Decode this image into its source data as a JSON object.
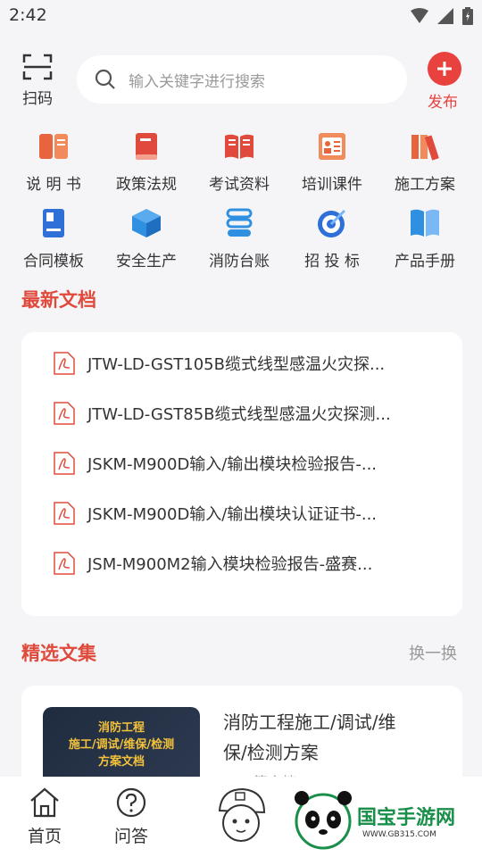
{
  "status": {
    "time": "2:42"
  },
  "topbar": {
    "scan_label": "扫码",
    "search_placeholder": "输入关键字进行搜索",
    "publish_label": "发布"
  },
  "categories": [
    {
      "label": "说 明 书",
      "icon": "book-open-icon",
      "color": "#e8643c"
    },
    {
      "label": "政策法规",
      "icon": "book-icon",
      "color": "#e04a3c"
    },
    {
      "label": "考试资料",
      "icon": "open-book-icon",
      "color": "#e04a3c"
    },
    {
      "label": "培训课件",
      "icon": "presentation-icon",
      "color": "#e8643c"
    },
    {
      "label": "施工方案",
      "icon": "books-icon",
      "color": "#e8643c"
    },
    {
      "label": "合同模板",
      "icon": "contract-icon",
      "color": "#2f6fd8"
    },
    {
      "label": "安全生产",
      "icon": "box-icon",
      "color": "#2f8fe0"
    },
    {
      "label": "消防台账",
      "icon": "stack-icon",
      "color": "#2f8fe0"
    },
    {
      "label": "招 投 标",
      "icon": "target-icon",
      "color": "#2f6fd8"
    },
    {
      "label": "产品手册",
      "icon": "manual-icon",
      "color": "#2f8fe0"
    }
  ],
  "latest": {
    "title": "最新文档",
    "docs": [
      "JTW-LD-GST105B缆式线型感温火灾探...",
      "JTW-LD-GST85B缆式线型感温火灾探测...",
      "JSKM-M900D输入/输出模块检验报告-...",
      "JSKM-M900D输入/输出模块认证证书-...",
      "JSM-M900M2输入模块检验报告-盛赛..."
    ]
  },
  "featured": {
    "title": "精选文集",
    "more": "换一换",
    "item": {
      "cover_text": [
        "消防工程",
        "施工/调试/维保/检测",
        "方案文档"
      ],
      "title_line1": "消防工程施工/调试/维",
      "title_line2": "保/检测方案",
      "count": "篇文档"
    }
  },
  "tabs": [
    {
      "label": "首页",
      "icon": "home-icon"
    },
    {
      "label": "问答",
      "icon": "question-icon"
    }
  ],
  "watermark": {
    "text": "国宝手游网",
    "url": "WWW.GB315.COM"
  },
  "colors": {
    "accent": "#e8413e",
    "title": "#e04a3c",
    "blue": "#2f8fe0"
  }
}
